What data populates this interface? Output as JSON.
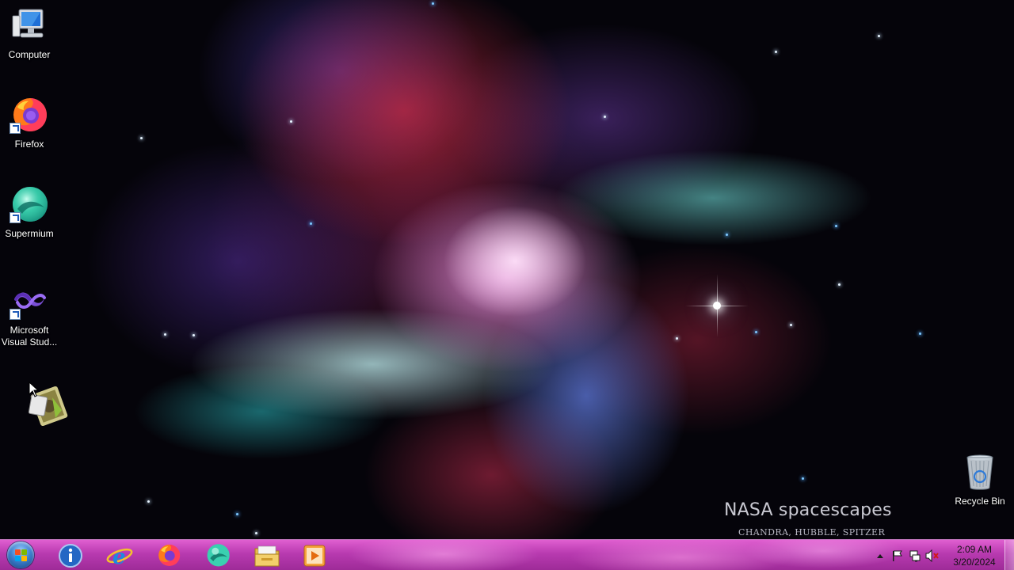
{
  "wallpaper": {
    "title": "NASA spacescapes",
    "subtitle": "CHANDRA, HUBBLE, SPITZER"
  },
  "desktop_icons": [
    {
      "label": "Computer",
      "icon": "computer-icon"
    },
    {
      "label": "Firefox",
      "icon": "firefox-icon"
    },
    {
      "label": "Supermium",
      "icon": "supermium-icon"
    },
    {
      "label": "Microsoft Visual Stud...",
      "icon": "visual-studio-icon"
    },
    {
      "label": "",
      "icon": "setup-program-icon"
    },
    {
      "label": "Recycle Bin",
      "icon": "recycle-bin-icon"
    }
  ],
  "taskbar": {
    "pinned": [
      {
        "icon": "start-orb-icon"
      },
      {
        "icon": "info-icon"
      },
      {
        "icon": "internet-explorer-icon"
      },
      {
        "icon": "firefox-icon"
      },
      {
        "icon": "supermium-icon"
      },
      {
        "icon": "file-explorer-icon"
      },
      {
        "icon": "media-player-icon"
      }
    ],
    "tray": {
      "icons": [
        "show-hidden-icons-icon",
        "action-center-flag-icon",
        "network-icon",
        "volume-muted-icon"
      ],
      "time": "2:09 AM",
      "date": "3/20/2024"
    }
  },
  "colors": {
    "taskbar": "#b83ab0",
    "desktop_text": "#ffffff"
  }
}
